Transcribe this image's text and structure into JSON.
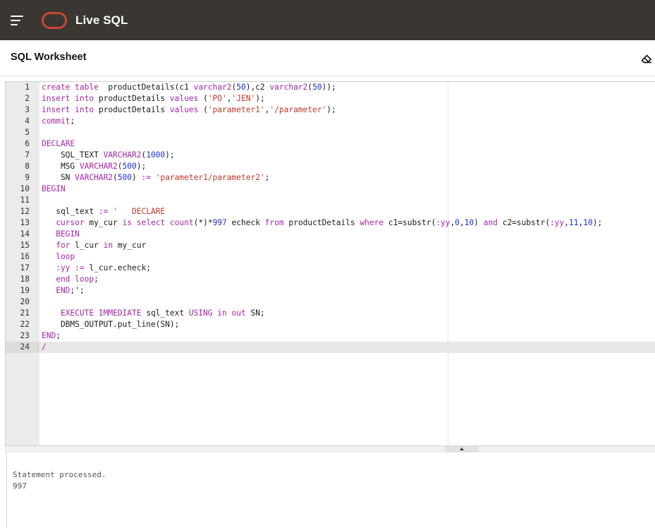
{
  "header": {
    "app_title": "Live SQL",
    "menu_icon": "hamburger-menu-icon",
    "logo": "oracle-logo",
    "brand_color": "#c74634",
    "bar_color": "#3a3631"
  },
  "worksheet": {
    "title": "SQL Worksheet",
    "clear_icon": "eraser-icon"
  },
  "editor": {
    "active_line": 24,
    "lines": [
      {
        "n": "1",
        "tokens": [
          [
            "kw",
            "create"
          ],
          [
            "t",
            " "
          ],
          [
            "kw",
            "table"
          ],
          [
            "t",
            "  productDetails(c1 "
          ],
          [
            "kw",
            "varchar2"
          ],
          [
            "t",
            "("
          ],
          [
            "num",
            "50"
          ],
          [
            "t",
            "),c2 "
          ],
          [
            "kw",
            "varchar2"
          ],
          [
            "t",
            "("
          ],
          [
            "num",
            "50"
          ],
          [
            "t",
            "));"
          ]
        ]
      },
      {
        "n": "2",
        "tokens": [
          [
            "kw",
            "insert"
          ],
          [
            "t",
            " "
          ],
          [
            "kw",
            "into"
          ],
          [
            "t",
            " productDetails "
          ],
          [
            "kw",
            "values"
          ],
          [
            "t",
            " ("
          ],
          [
            "str",
            "'PO'"
          ],
          [
            "t",
            ","
          ],
          [
            "str",
            "'JEN'"
          ],
          [
            "t",
            ");"
          ]
        ]
      },
      {
        "n": "3",
        "tokens": [
          [
            "kw",
            "insert"
          ],
          [
            "t",
            " "
          ],
          [
            "kw",
            "into"
          ],
          [
            "t",
            " productDetails "
          ],
          [
            "kw",
            "values"
          ],
          [
            "t",
            " ("
          ],
          [
            "str",
            "'parameter1'"
          ],
          [
            "t",
            ","
          ],
          [
            "str",
            "'/parameter'"
          ],
          [
            "t",
            ");"
          ]
        ]
      },
      {
        "n": "4",
        "tokens": [
          [
            "kw",
            "commit"
          ],
          [
            "t",
            ";"
          ]
        ]
      },
      {
        "n": "5",
        "tokens": []
      },
      {
        "n": "6",
        "tokens": [
          [
            "kw",
            "DECLARE"
          ]
        ]
      },
      {
        "n": "7",
        "tokens": [
          [
            "t",
            "    SQL_TEXT "
          ],
          [
            "kw",
            "VARCHAR2"
          ],
          [
            "t",
            "("
          ],
          [
            "num",
            "1000"
          ],
          [
            "t",
            ");"
          ]
        ]
      },
      {
        "n": "8",
        "tokens": [
          [
            "t",
            "    MSG "
          ],
          [
            "kw",
            "VARCHAR2"
          ],
          [
            "t",
            "("
          ],
          [
            "num",
            "500"
          ],
          [
            "t",
            ");"
          ]
        ]
      },
      {
        "n": "9",
        "tokens": [
          [
            "t",
            "    SN "
          ],
          [
            "kw",
            "VARCHAR2"
          ],
          [
            "t",
            "("
          ],
          [
            "num",
            "500"
          ],
          [
            "t",
            ") "
          ],
          [
            "kw",
            ":="
          ],
          [
            "t",
            " "
          ],
          [
            "str",
            "'parameter1/parameter2'"
          ],
          [
            "t",
            ";"
          ]
        ]
      },
      {
        "n": "10",
        "tokens": [
          [
            "kw",
            "BEGIN"
          ]
        ]
      },
      {
        "n": "11",
        "tokens": []
      },
      {
        "n": "12",
        "tokens": [
          [
            "t",
            "   sql_text "
          ],
          [
            "kw",
            ":="
          ],
          [
            "t",
            " "
          ],
          [
            "str",
            "'   DECLARE"
          ]
        ]
      },
      {
        "n": "13",
        "tokens": [
          [
            "kw",
            "   cursor"
          ],
          [
            "t",
            " my_cur "
          ],
          [
            "kw",
            "is"
          ],
          [
            "t",
            " "
          ],
          [
            "kw",
            "select"
          ],
          [
            "t",
            " "
          ],
          [
            "kw",
            "count"
          ],
          [
            "t",
            "(*)*"
          ],
          [
            "num",
            "997"
          ],
          [
            "t",
            " echeck "
          ],
          [
            "kw",
            "from"
          ],
          [
            "t",
            " productDetails "
          ],
          [
            "kw",
            "where"
          ],
          [
            "t",
            " c1=substr("
          ],
          [
            "kw",
            ":yy"
          ],
          [
            "t",
            ","
          ],
          [
            "num",
            "0"
          ],
          [
            "t",
            ","
          ],
          [
            "num",
            "10"
          ],
          [
            "t",
            ") "
          ],
          [
            "kw",
            "and"
          ],
          [
            "t",
            " c2=substr("
          ],
          [
            "kw",
            ":yy"
          ],
          [
            "t",
            ","
          ],
          [
            "num",
            "11"
          ],
          [
            "t",
            ","
          ],
          [
            "num",
            "10"
          ],
          [
            "t",
            ");"
          ]
        ]
      },
      {
        "n": "14",
        "tokens": [
          [
            "kw",
            "   BEGIN"
          ]
        ]
      },
      {
        "n": "15",
        "tokens": [
          [
            "kw",
            "   for"
          ],
          [
            "t",
            " l_cur "
          ],
          [
            "kw",
            "in"
          ],
          [
            "t",
            " my_cur"
          ]
        ]
      },
      {
        "n": "16",
        "tokens": [
          [
            "kw",
            "   loop"
          ]
        ]
      },
      {
        "n": "17",
        "tokens": [
          [
            "kw",
            "   :yy"
          ],
          [
            "t",
            " "
          ],
          [
            "kw",
            ":="
          ],
          [
            "t",
            " l_cur.echeck;"
          ]
        ]
      },
      {
        "n": "18",
        "tokens": [
          [
            "kw",
            "   end"
          ],
          [
            "t",
            " "
          ],
          [
            "kw",
            "loop"
          ],
          [
            "t",
            ";"
          ]
        ]
      },
      {
        "n": "19",
        "tokens": [
          [
            "kw",
            "   END"
          ],
          [
            "t",
            ";';"
          ]
        ]
      },
      {
        "n": "20",
        "tokens": []
      },
      {
        "n": "21",
        "tokens": [
          [
            "kw",
            "    EXECUTE"
          ],
          [
            "t",
            " "
          ],
          [
            "kw",
            "IMMEDIATE"
          ],
          [
            "t",
            " sql_text "
          ],
          [
            "kw",
            "USING"
          ],
          [
            "t",
            " "
          ],
          [
            "kw",
            "in"
          ],
          [
            "t",
            " "
          ],
          [
            "kw",
            "out"
          ],
          [
            "t",
            " SN;"
          ]
        ]
      },
      {
        "n": "22",
        "tokens": [
          [
            "t",
            "    DBMS_OUTPUT.put_line(SN);"
          ]
        ]
      },
      {
        "n": "23",
        "tokens": [
          [
            "kw",
            "END"
          ],
          [
            "t",
            ";"
          ]
        ]
      },
      {
        "n": "24",
        "tokens": [
          [
            "kw",
            "/"
          ]
        ]
      }
    ]
  },
  "output": {
    "lines": [
      "Statement processed.",
      "997"
    ]
  }
}
